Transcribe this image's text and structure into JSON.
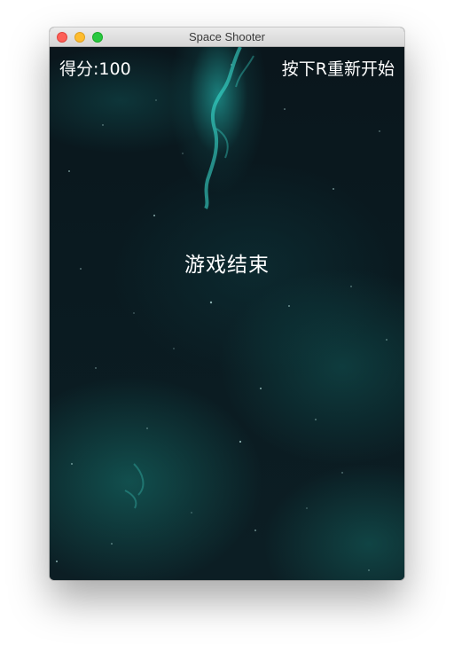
{
  "window": {
    "title": "Space Shooter"
  },
  "hud": {
    "score_label": "得分:100",
    "score_value": 100,
    "restart_hint": "按下R重新开始"
  },
  "overlay": {
    "game_over": "游戏结束"
  },
  "colors": {
    "text": "#ffffff",
    "space_background": "#0b141a",
    "nebula_accent": "#28d2c8"
  }
}
